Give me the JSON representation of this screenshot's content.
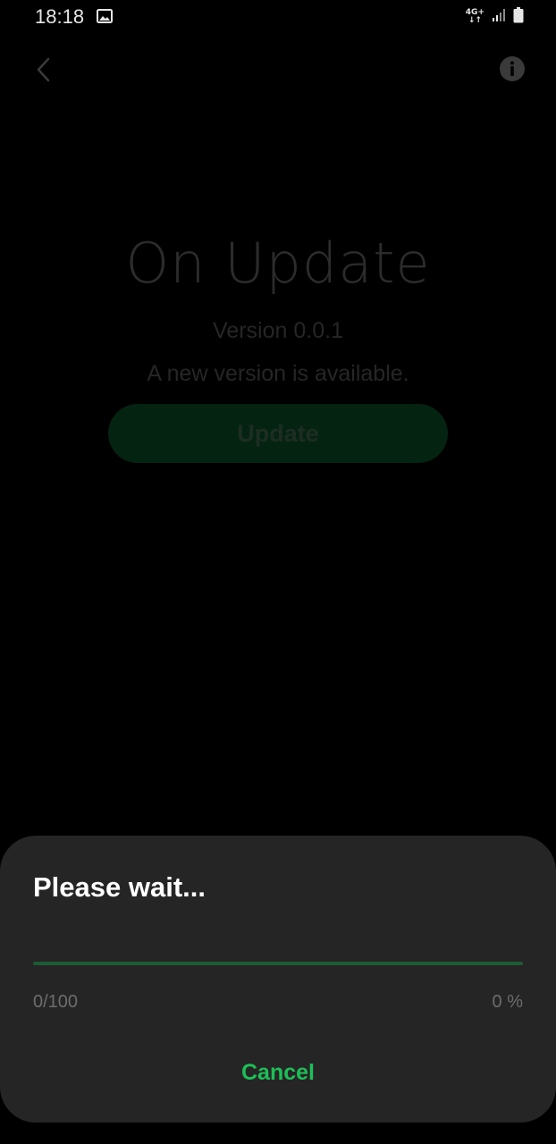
{
  "status_bar": {
    "time": "18:18",
    "network_top": "4G+",
    "network_bottom": "↓↑",
    "icons": [
      "gallery-icon",
      "signal-icon",
      "battery-icon"
    ]
  },
  "app_bar": {
    "back_icon": "chevron-left-icon",
    "info_icon": "info-icon"
  },
  "main": {
    "title": "On Update",
    "version": "Version 0.0.1",
    "availability": "A new version is available.",
    "update_label": "Update"
  },
  "dialog": {
    "title": "Please wait...",
    "progress_fraction": 0,
    "progress_count": "0/100",
    "progress_percent": "0 %",
    "cancel_label": "Cancel"
  },
  "colors": {
    "background": "#000000",
    "dialog_bg": "#252525",
    "accent": "#1fbd58",
    "progress_track": "#1e5a36",
    "dim_button": "#042411"
  }
}
